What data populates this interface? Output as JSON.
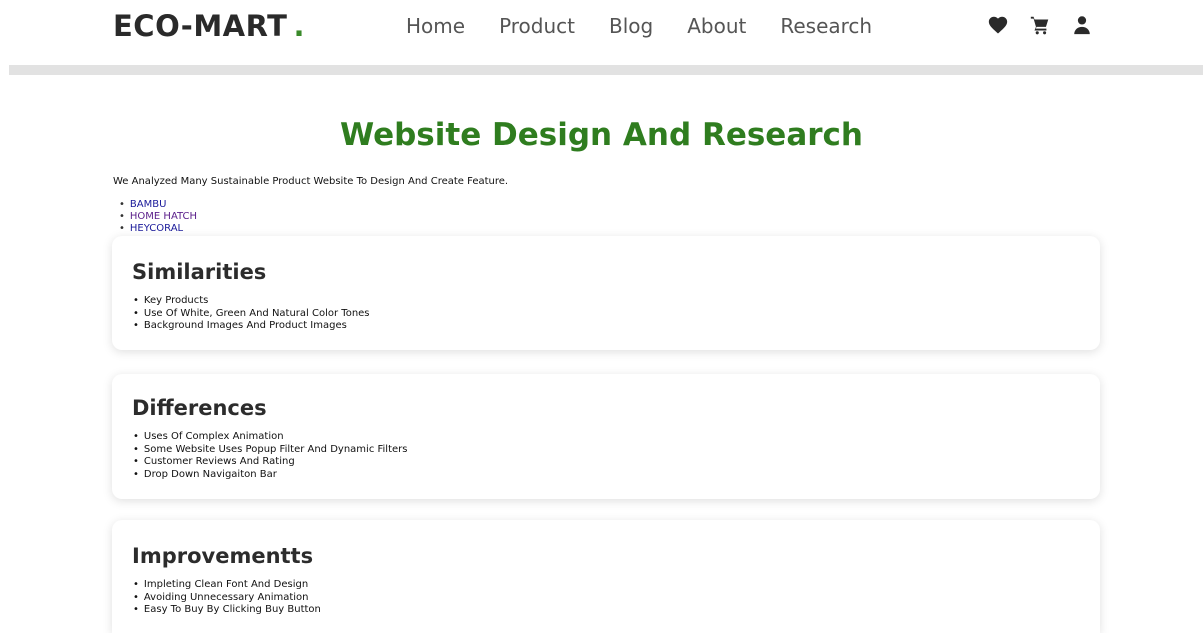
{
  "header": {
    "logo_text": "ECO-MART",
    "logo_dot": ".",
    "nav": [
      "Home",
      "Product",
      "Blog",
      "About",
      "Research"
    ],
    "icons": [
      "heart-icon",
      "cart-icon",
      "user-icon"
    ]
  },
  "main": {
    "title": "Website Design And Research",
    "intro": "We Analyzed Many Sustainable Product Website To Design And Create Feature.",
    "sites": [
      "BAMBU",
      "HOME HATCH",
      "HEYCORAL"
    ]
  },
  "sections": {
    "similarities": {
      "heading": "Similarities",
      "items": [
        "Key Products",
        "Use Of White, Green And Natural Color Tones",
        "Background Images And Product Images"
      ]
    },
    "differences": {
      "heading": "Differences",
      "items": [
        "Uses Of Complex Animation",
        "Some Website Uses Popup Filter And Dynamic Filters",
        "Customer Reviews And Rating",
        "Drop Down Navigaiton Bar"
      ]
    },
    "improvements": {
      "heading": "Improvementts",
      "items": [
        "Impleting Clean Font And Design",
        "Avoiding Unnecessary Animation",
        "Easy To Buy By Clicking Buy Button"
      ]
    }
  },
  "colors": {
    "brand_green": "#2f7d1f",
    "logo_dot": "#3a8a2a",
    "text_dark": "#2c2c2c"
  }
}
